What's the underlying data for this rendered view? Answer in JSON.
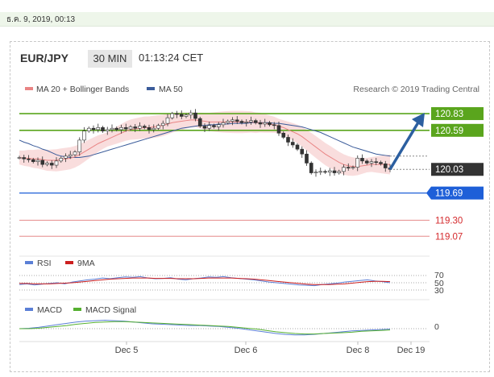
{
  "timestamp": "ธ.ค. 9, 2019, 00:13",
  "header": {
    "pair": "EUR/JPY",
    "timeframe": "30 MIN",
    "time": "01:13:24 CET"
  },
  "legend": {
    "ma20": "MA 20 + Bollinger Bands",
    "ma50": "MA 50",
    "research": "Research © 2019 Trading Central"
  },
  "colors": {
    "green": "#5aa51d",
    "blue": "#1e5fd8",
    "red": "#d4292c",
    "ma20": "#e98484",
    "ma50": "#3b5c9a",
    "band": "#f7d5d5",
    "rsi": "#5b7fd6",
    "ma9": "#cc1f1f",
    "macd": "#5b7fd6",
    "signal": "#55b030",
    "current": "#333333"
  },
  "chart_data": [
    {
      "type": "candlestick",
      "title": "EUR/JPY",
      "timeframe": "30 MIN",
      "x_ticks": [
        "Dec 5",
        "Dec 6",
        "Dec 8",
        "Dec 19"
      ],
      "y_range": [
        118.9,
        121.05
      ],
      "levels": [
        {
          "label": "120.83",
          "value": 120.83,
          "kind": "resistance",
          "color": "#5aa51d"
        },
        {
          "label": "120.59",
          "value": 120.59,
          "kind": "resistance",
          "color": "#5aa51d"
        },
        {
          "label": "120.03",
          "value": 120.03,
          "kind": "current",
          "color": "#333333"
        },
        {
          "label": "119.69",
          "value": 119.69,
          "kind": "pivot",
          "color": "#1e5fd8"
        },
        {
          "label": "119.30",
          "value": 119.3,
          "kind": "support",
          "color": "#d4292c"
        },
        {
          "label": "119.07",
          "value": 119.07,
          "kind": "support",
          "color": "#d4292c"
        }
      ],
      "close": [
        120.2,
        120.18,
        120.17,
        120.14,
        120.16,
        120.1,
        120.12,
        120.09,
        120.15,
        120.19,
        120.22,
        120.24,
        120.28,
        120.45,
        120.58,
        120.62,
        120.6,
        120.63,
        120.58,
        120.6,
        120.62,
        120.6,
        120.63,
        120.61,
        120.64,
        120.62,
        120.65,
        120.63,
        120.6,
        120.62,
        120.66,
        120.69,
        120.77,
        120.83,
        120.82,
        120.79,
        120.81,
        120.84,
        120.76,
        120.65,
        120.62,
        120.66,
        120.64,
        120.67,
        120.7,
        120.72,
        120.74,
        120.72,
        120.7,
        120.71,
        120.73,
        120.7,
        120.68,
        120.7,
        120.67,
        120.66,
        120.55,
        120.49,
        120.42,
        120.38,
        120.32,
        120.25,
        120.12,
        119.98,
        119.99,
        120.0,
        119.99,
        120.01,
        119.98,
        120.0,
        120.06,
        120.05,
        120.06,
        120.19,
        120.15,
        120.12,
        120.14,
        120.13,
        120.11,
        120.05,
        120.03
      ],
      "ma20": [
        120.2,
        120.19,
        120.19,
        120.18,
        120.18,
        120.17,
        120.16,
        120.16,
        120.16,
        120.17,
        120.18,
        120.19,
        120.21,
        120.24,
        120.28,
        120.32,
        120.36,
        120.4,
        120.43,
        120.46,
        120.49,
        120.52,
        120.55,
        120.58,
        120.6,
        120.61,
        120.62,
        120.63,
        120.63,
        120.64,
        120.65,
        120.66,
        120.68,
        120.7,
        120.71,
        120.72,
        120.73,
        120.74,
        120.74,
        120.73,
        120.72,
        120.71,
        120.71,
        120.71,
        120.71,
        120.71,
        120.71,
        120.71,
        120.71,
        120.71,
        120.71,
        120.7,
        120.7,
        120.69,
        120.68,
        120.67,
        120.65,
        120.63,
        120.6,
        120.57,
        120.54,
        120.5,
        120.45,
        120.4,
        120.35,
        120.3,
        120.25,
        120.21,
        120.17,
        120.13,
        120.1,
        120.08,
        120.07,
        120.07,
        120.08,
        120.09,
        120.1,
        120.1,
        120.1,
        120.1,
        120.1
      ],
      "ma50": [
        120.45,
        120.42,
        120.4,
        120.37,
        120.35,
        120.32,
        120.3,
        120.27,
        120.24,
        120.22,
        120.21,
        120.2,
        120.2,
        120.2,
        120.21,
        120.22,
        120.24,
        120.26,
        120.28,
        120.3,
        120.32,
        120.34,
        120.36,
        120.38,
        120.4,
        120.42,
        120.44,
        120.46,
        120.48,
        120.5,
        120.52,
        120.54,
        120.56,
        120.58,
        120.6,
        120.62,
        120.63,
        120.64,
        120.65,
        120.66,
        120.66,
        120.67,
        120.67,
        120.68,
        120.68,
        120.68,
        120.69,
        120.69,
        120.69,
        120.69,
        120.7,
        120.7,
        120.7,
        120.7,
        120.7,
        120.69,
        120.69,
        120.68,
        120.67,
        120.66,
        120.65,
        120.64,
        120.62,
        120.6,
        120.58,
        120.56,
        120.53,
        120.5,
        120.47,
        120.44,
        120.41,
        120.38,
        120.35,
        120.33,
        120.31,
        120.29,
        120.27,
        120.25,
        120.24,
        120.23,
        120.22
      ],
      "forecast": {
        "from": 120.03,
        "to": 120.83
      }
    },
    {
      "type": "line",
      "title": "RSI",
      "series": [
        {
          "name": "RSI",
          "values": [
            45,
            47,
            44,
            46,
            48,
            50,
            47,
            52,
            55,
            58,
            60,
            63,
            61,
            64,
            66,
            65,
            67,
            63,
            61,
            62,
            64,
            60,
            58,
            61,
            63,
            66,
            65,
            67,
            64,
            62,
            60,
            58,
            55,
            52,
            50,
            48,
            46,
            44,
            43,
            42,
            45,
            47,
            49,
            52,
            54,
            56,
            58,
            55,
            53,
            50
          ]
        },
        {
          "name": "9MA",
          "values": [
            48,
            48,
            47,
            47,
            47,
            48,
            49,
            50,
            52,
            54,
            56,
            58,
            60,
            61,
            62,
            63,
            63,
            63,
            62,
            62,
            62,
            61,
            61,
            61,
            62,
            63,
            63,
            63,
            63,
            62,
            61,
            60,
            58,
            56,
            54,
            52,
            50,
            48,
            46,
            45,
            45,
            45,
            46,
            47,
            49,
            51,
            53,
            54,
            54,
            53
          ]
        }
      ],
      "yticks": [
        "70",
        "50",
        "30"
      ]
    },
    {
      "type": "line",
      "title": "MACD",
      "series": [
        {
          "name": "MACD",
          "values": [
            0.0,
            0.01,
            0.03,
            0.06,
            0.09,
            0.12,
            0.15,
            0.17,
            0.18,
            0.19,
            0.18,
            0.17,
            0.15,
            0.13,
            0.11,
            0.1,
            0.09,
            0.08,
            0.07,
            0.07,
            0.06,
            0.05,
            0.03,
            0.01,
            -0.02,
            -0.05,
            -0.08,
            -0.11,
            -0.13,
            -0.14,
            -0.14,
            -0.13,
            -0.11,
            -0.09,
            -0.07,
            -0.05,
            -0.04,
            -0.03,
            -0.02,
            -0.01
          ]
        },
        {
          "name": "MACD Signal",
          "values": [
            0.0,
            0.0,
            0.01,
            0.03,
            0.05,
            0.07,
            0.1,
            0.12,
            0.14,
            0.15,
            0.16,
            0.16,
            0.15,
            0.14,
            0.13,
            0.12,
            0.11,
            0.1,
            0.09,
            0.08,
            0.07,
            0.06,
            0.05,
            0.03,
            0.01,
            -0.01,
            -0.04,
            -0.07,
            -0.09,
            -0.11,
            -0.12,
            -0.12,
            -0.11,
            -0.1,
            -0.09,
            -0.08,
            -0.06,
            -0.05,
            -0.04,
            -0.03
          ]
        }
      ],
      "yticks": [
        "0"
      ]
    }
  ]
}
